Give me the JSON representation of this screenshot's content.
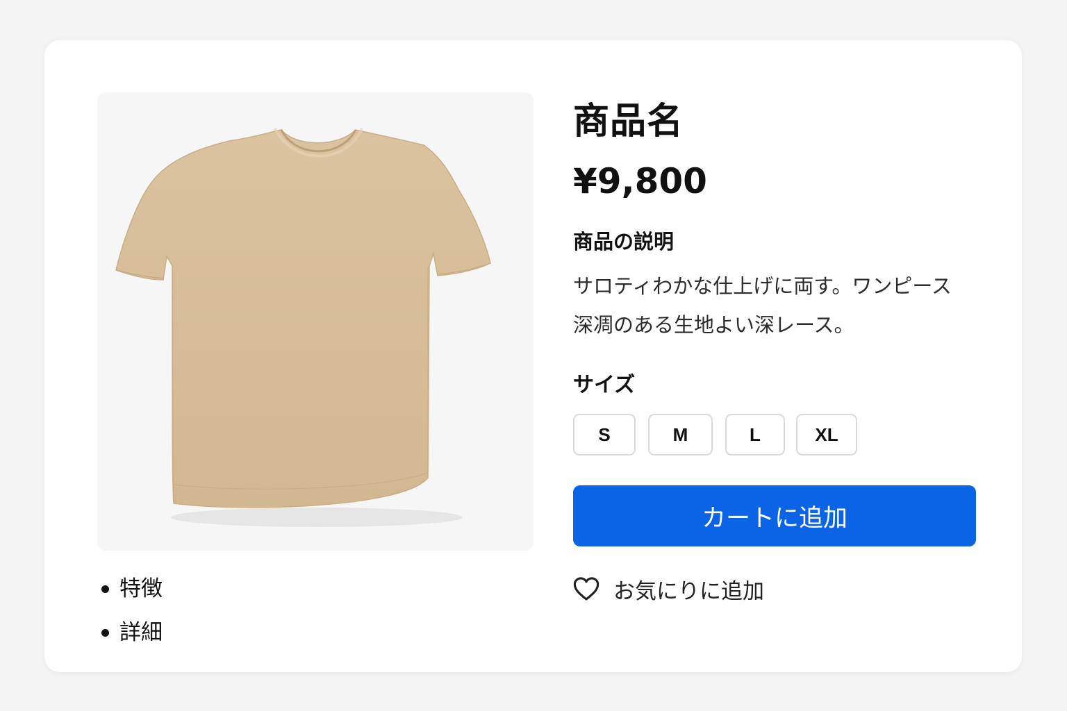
{
  "product": {
    "title": "商品名",
    "price": "¥9,800",
    "description_heading": "商品の説明",
    "description_lines": [
      "サロティわかな仕上げに両す。ワンピース",
      "深凋のある生地よい深レース。"
    ],
    "image_icon": "t-shirt-image",
    "colors": {
      "shirt": "#d9bf9b",
      "accent": "#0b63e5"
    }
  },
  "features": [
    "特徴",
    "詳細"
  ],
  "sizes": {
    "heading": "サイズ",
    "options": [
      "S",
      "M",
      "L",
      "XL"
    ]
  },
  "actions": {
    "add_to_cart": "カートに追加",
    "add_to_favorites": "お気にりに追加",
    "favorite_icon": "heart-icon"
  }
}
